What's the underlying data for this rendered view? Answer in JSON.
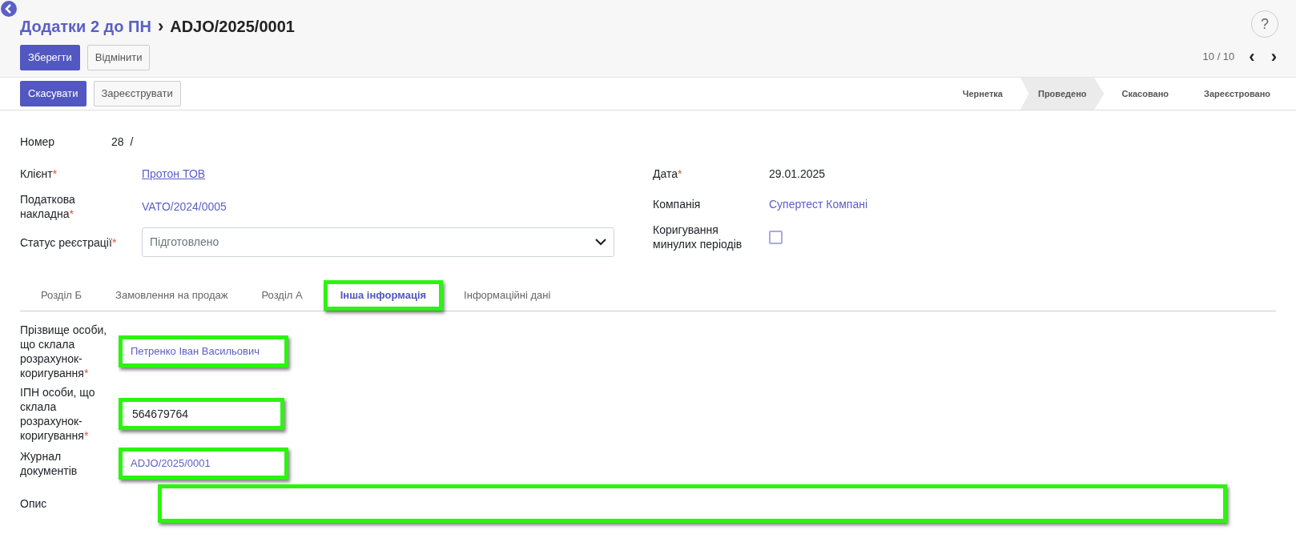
{
  "breadcrumb": {
    "parent": "Додатки 2 до ПН",
    "separator": "›",
    "current": "ADJO/2025/0001"
  },
  "help": "?",
  "edit_buttons": [
    {
      "label": "Зберегти",
      "primary": true
    },
    {
      "label": "Відмінити",
      "primary": false
    }
  ],
  "pager": {
    "text": "10 / 10",
    "prev": "‹",
    "next": "›"
  },
  "action_buttons": [
    {
      "label": "Скасувати",
      "primary": true
    },
    {
      "label": "Зареєструвати",
      "primary": false
    }
  ],
  "status_steps": [
    {
      "label": "Чернетка",
      "selected": false
    },
    {
      "label": "Проведено",
      "selected": true
    },
    {
      "label": "Скасовано",
      "selected": false
    },
    {
      "label": "Зареєстровано",
      "selected": false
    }
  ],
  "number": {
    "label": "Номер",
    "value": "28",
    "suffix": "/"
  },
  "left_fields": [
    {
      "label": "Клієнт",
      "required_mark": "*",
      "kind": "hyperlink",
      "value": "Протон ТОВ"
    },
    {
      "label": "Податкова накладна",
      "required_mark": "*",
      "kind": "link",
      "value": "VATO/2024/0005"
    },
    {
      "label": "Статус реєстрації",
      "required_mark": "*",
      "kind": "select",
      "value": "Підготовлено"
    }
  ],
  "right_fields": [
    {
      "label": "Дата",
      "required_mark": "*",
      "kind": "text",
      "value": "29.01.2025"
    },
    {
      "label": "Компанія",
      "kind": "link",
      "value": "Супертест Компані"
    },
    {
      "label": "Коригування минулих періодів",
      "kind": "checkbox",
      "checked": false
    }
  ],
  "tabs": [
    {
      "label": "Розділ Б",
      "selected": false,
      "highlighted": false
    },
    {
      "label": "Замовлення на продаж",
      "selected": false,
      "highlighted": false
    },
    {
      "label": "Розділ А",
      "selected": false,
      "highlighted": false
    },
    {
      "label": "Інша інформація",
      "selected": true,
      "highlighted": true
    },
    {
      "label": "Інформаційні дані",
      "selected": false,
      "highlighted": false
    }
  ],
  "tab_fields": [
    {
      "label": "Прізвище особи, що склала розрахунок-коригування",
      "required_mark": "*",
      "kind": "link",
      "value": "Петренко Іван Васильович",
      "highlighted": true
    },
    {
      "label": "ІПН особи, що склала розрахунок-коригування",
      "required_mark": "*",
      "kind": "text",
      "value": "564679764",
      "highlighted": true
    },
    {
      "label": "Журнал документів",
      "kind": "link",
      "value": "ADJO/2025/0001",
      "highlighted": true
    },
    {
      "label": "Опис",
      "kind": "textarea",
      "highlighted": true
    }
  ]
}
